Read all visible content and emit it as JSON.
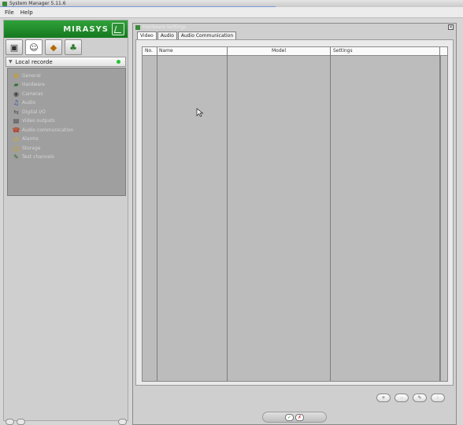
{
  "app": {
    "title": "System Manager 5.11.6"
  },
  "menu": [
    "File",
    "Help"
  ],
  "left": {
    "brand": "MIRASYS",
    "mode_tabs": [
      "servers-icon",
      "user-icon",
      "license-icon",
      "plugin-icon"
    ],
    "tree_header": "Local recorde",
    "tree_items": [
      {
        "icon": "gear-icon",
        "label": "General"
      },
      {
        "icon": "hardware-icon",
        "label": "Hardware"
      },
      {
        "icon": "camera-icon",
        "label": "Cameras"
      },
      {
        "icon": "audio-icon",
        "label": "Audio"
      },
      {
        "icon": "digital-io-icon",
        "label": "Digital I/O"
      },
      {
        "icon": "video-outputs-icon",
        "label": "Video outputs"
      },
      {
        "icon": "audio-communication-icon",
        "label": "Audio communication"
      },
      {
        "icon": "alarm-icon",
        "label": "Alarms"
      },
      {
        "icon": "storage-icon",
        "label": "Storage"
      },
      {
        "icon": "text-channels-icon",
        "label": "Text channels"
      }
    ]
  },
  "window": {
    "title": "Hardware Settings",
    "tabs": [
      "Video",
      "Audio",
      "Audio Communication"
    ],
    "active_tab": "Video",
    "columns": [
      "No.",
      "Name",
      "Model",
      "Settings"
    ]
  },
  "colors": {
    "brand_green": "#1f8f2b",
    "status_green": "#24c436",
    "cancel_red": "#c62828"
  }
}
